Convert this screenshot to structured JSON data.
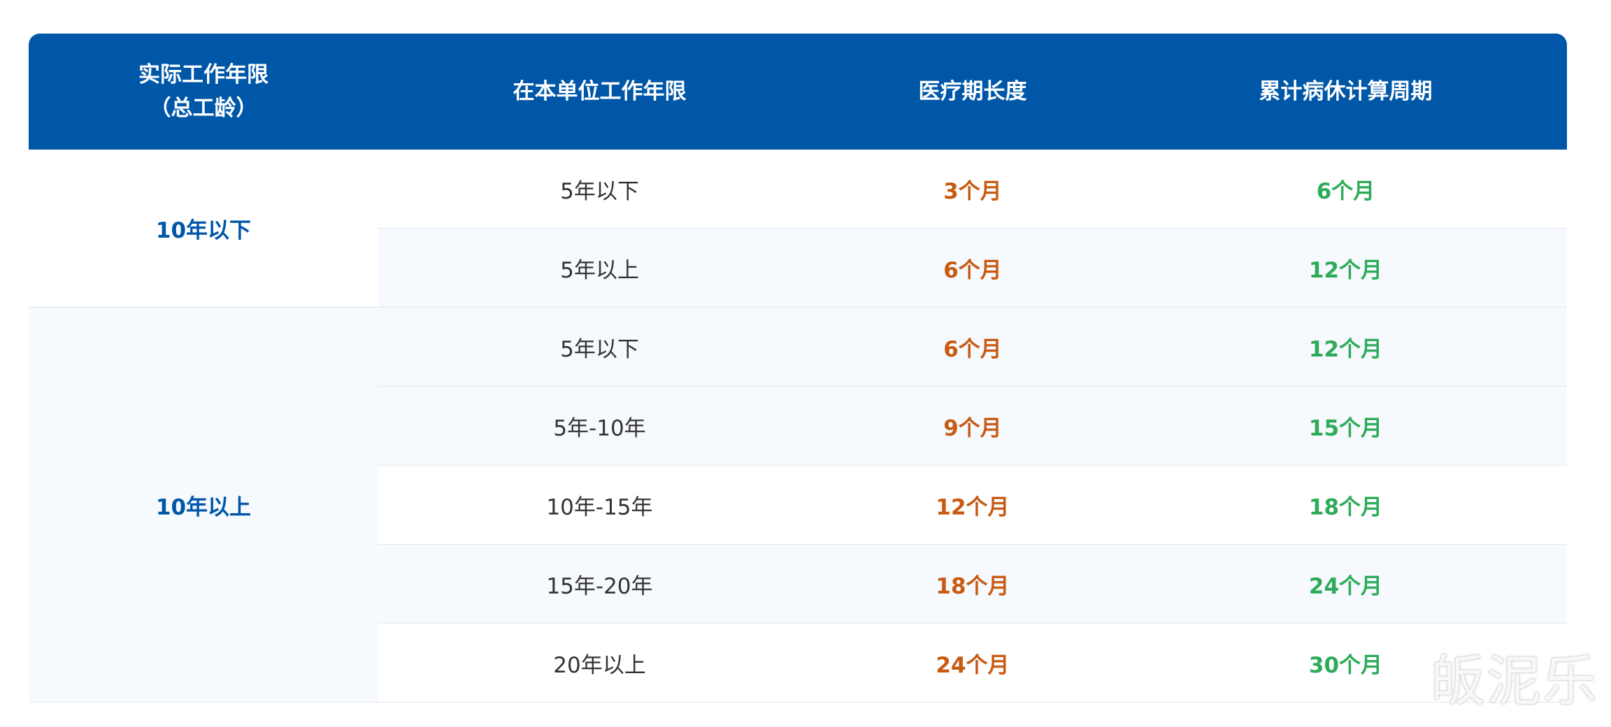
{
  "table": {
    "headers": {
      "col1_line1": "实际工作年限",
      "col1_line2": "（总工龄）",
      "col2": "在本单位工作年限",
      "col3": "医疗期长度",
      "col4": "累计病休计算周期"
    },
    "groups": [
      {
        "label": "10年以下",
        "rows": [
          {
            "tenure": "5年以下",
            "medical_period": "3个月",
            "cycle": "6个月"
          },
          {
            "tenure": "5年以上",
            "medical_period": "6个月",
            "cycle": "12个月"
          }
        ]
      },
      {
        "label": "10年以上",
        "rows": [
          {
            "tenure": "5年以下",
            "medical_period": "6个月",
            "cycle": "12个月"
          },
          {
            "tenure": "5年-10年",
            "medical_period": "9个月",
            "cycle": "15个月"
          },
          {
            "tenure": "10年-15年",
            "medical_period": "12个月",
            "cycle": "18个月"
          },
          {
            "tenure": "15年-20年",
            "medical_period": "18个月",
            "cycle": "24个月"
          },
          {
            "tenure": "20年以上",
            "medical_period": "24个月",
            "cycle": "30个月"
          }
        ]
      }
    ]
  },
  "watermark": "皈泥乐",
  "colors": {
    "header_bg": "#0057a8",
    "group_label": "#0057a8",
    "medical_period": "#c85a12",
    "cycle": "#2eab5a",
    "row_tint": "#f6f9fd"
  }
}
